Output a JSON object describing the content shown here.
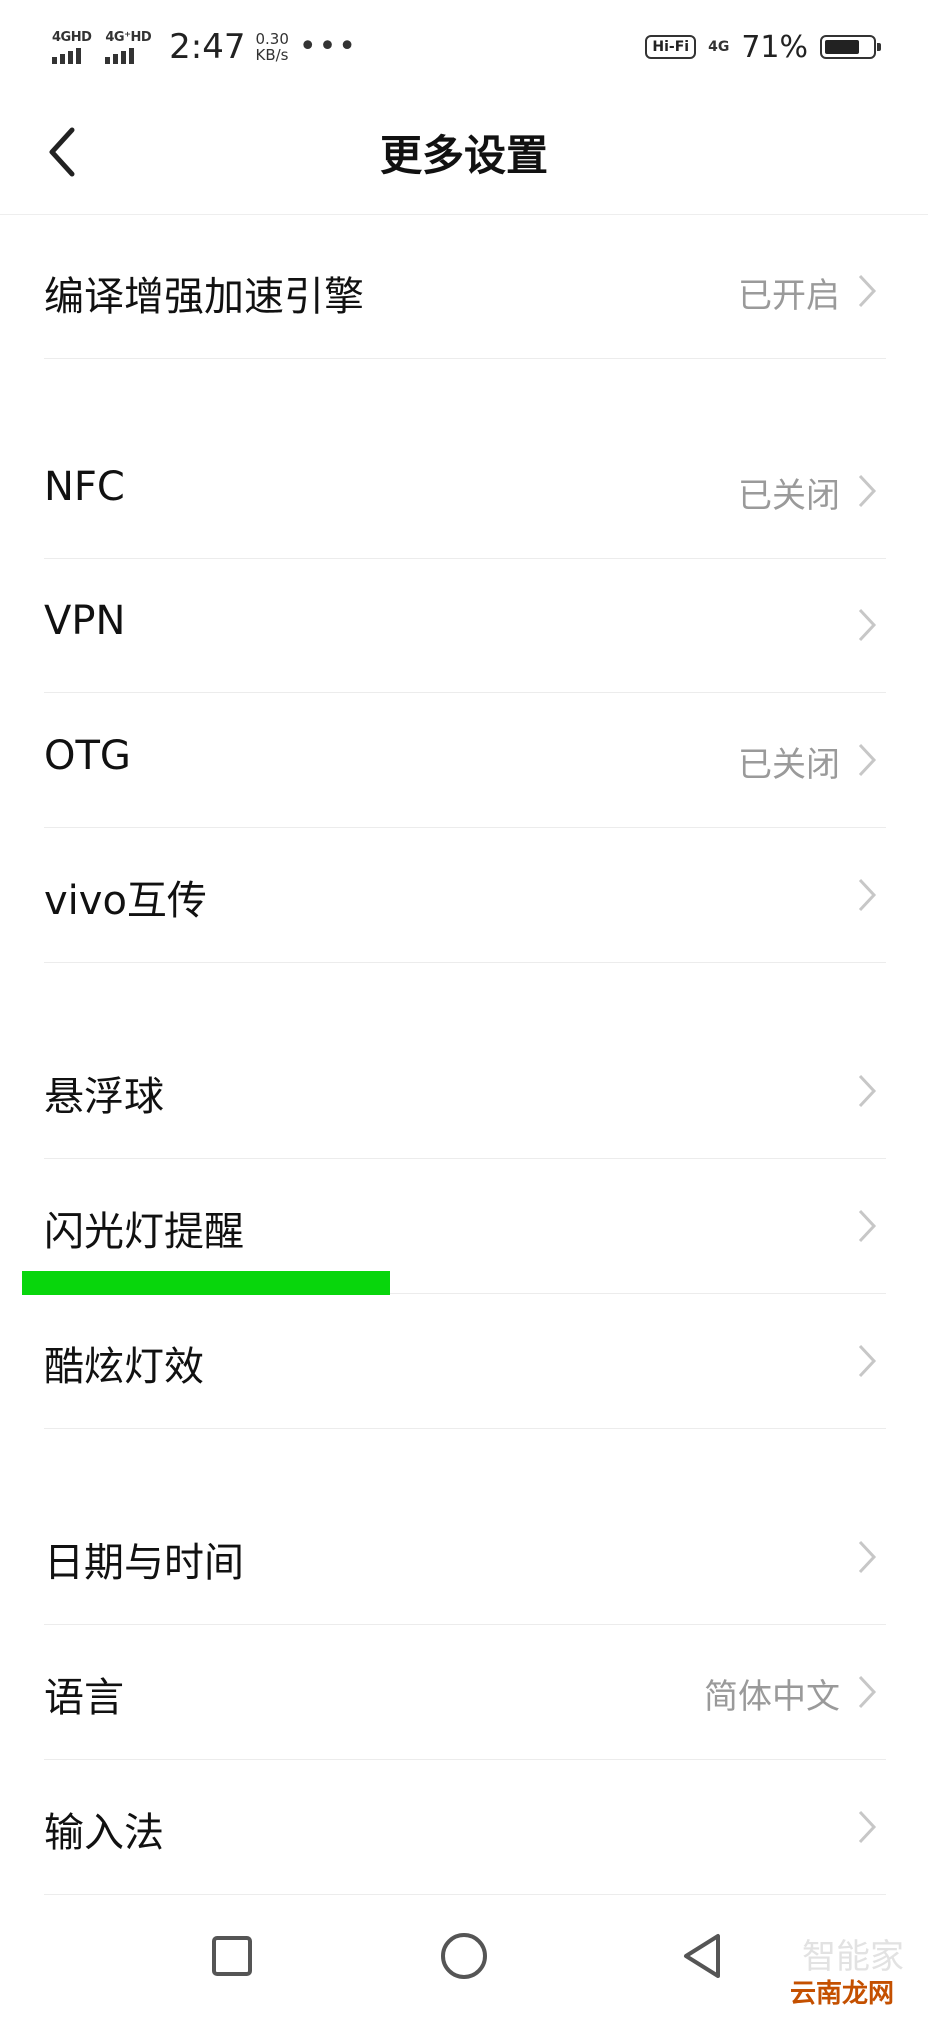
{
  "status_bar": {
    "sim1_label": "4GHD",
    "sim2_label": "4G⁺HD",
    "time": "2:47",
    "speed_value": "0.30",
    "speed_unit": "KB/s",
    "more_dots": "•••",
    "hifi_label": "Hi-Fi",
    "net_label": "4G",
    "battery_percent": "71%",
    "battery_level": 0.71
  },
  "header": {
    "title": "更多设置"
  },
  "rows": [
    {
      "label": "编译增强加速引擎",
      "value": "已开启"
    },
    {
      "label": "NFC",
      "value": "已关闭"
    },
    {
      "label": "VPN",
      "value": ""
    },
    {
      "label": "OTG",
      "value": "已关闭"
    },
    {
      "label": "vivo互传",
      "value": ""
    },
    {
      "label": "悬浮球",
      "value": ""
    },
    {
      "label": "闪光灯提醒",
      "value": ""
    },
    {
      "label": "酷炫灯效",
      "value": ""
    },
    {
      "label": "日期与时间",
      "value": ""
    },
    {
      "label": "语言",
      "value": "简体中文"
    },
    {
      "label": "输入法",
      "value": ""
    }
  ],
  "watermark": {
    "text": "云南龙网",
    "ghost": "智能家"
  },
  "colors": {
    "highlight": "#08d60c",
    "value_gray": "#9a9a9a"
  }
}
